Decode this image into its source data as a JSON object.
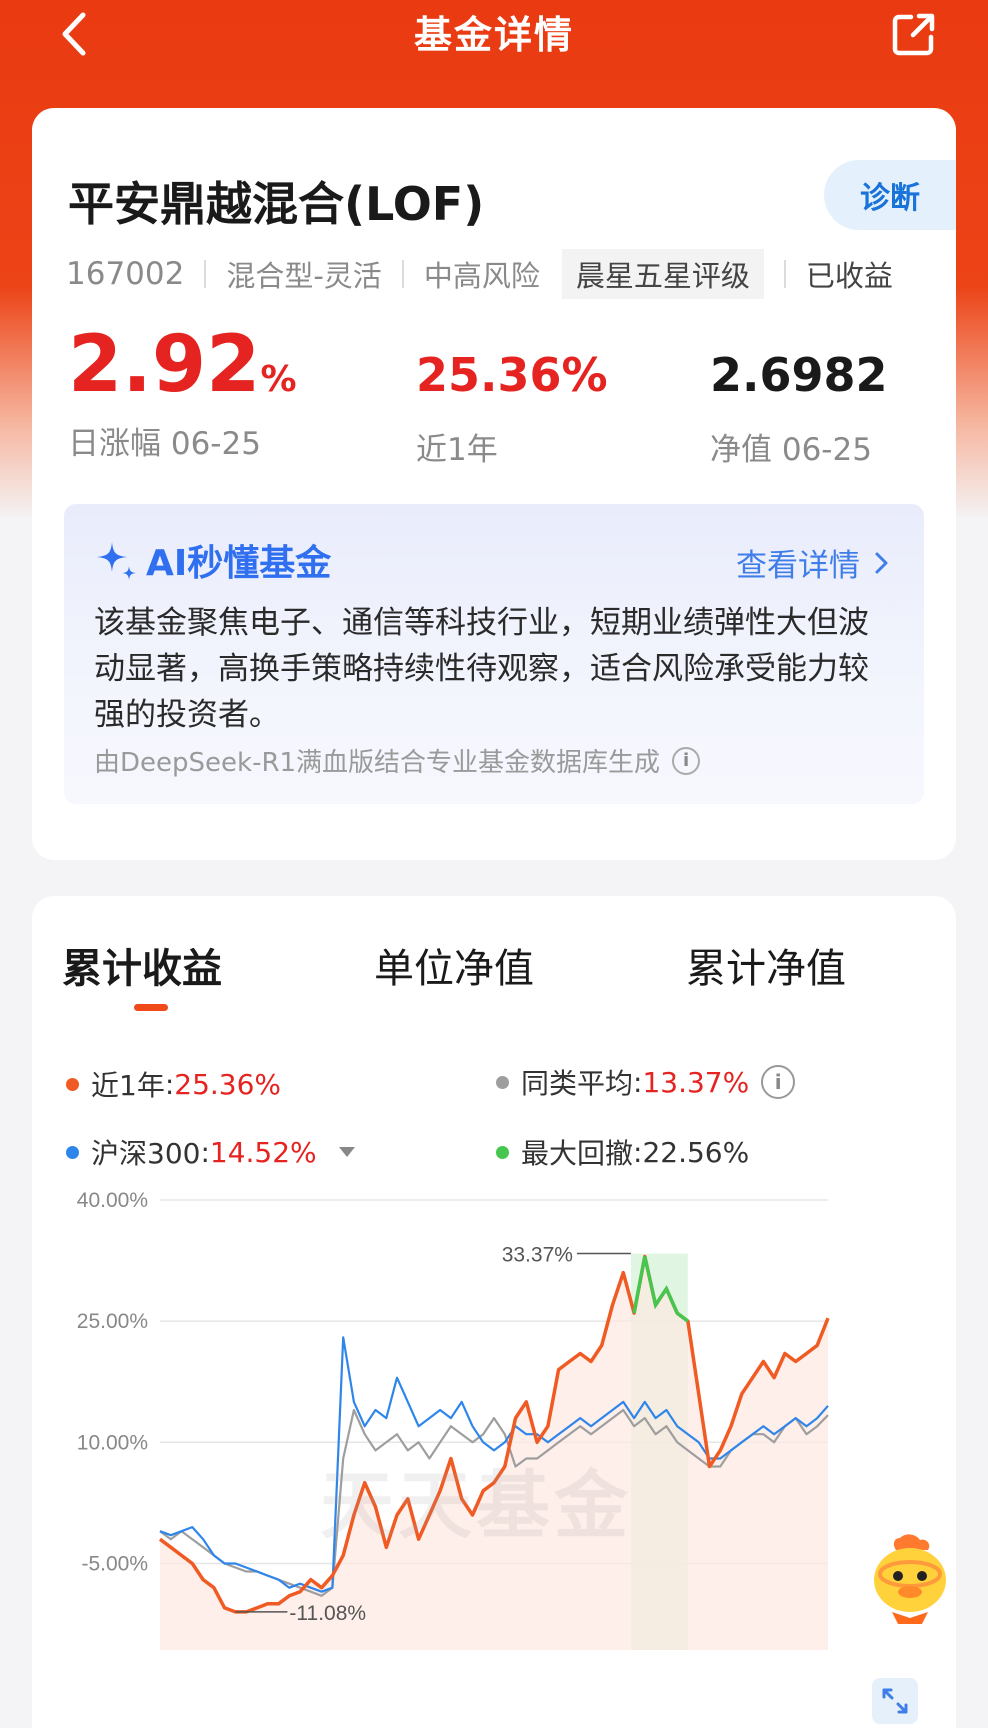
{
  "nav": {
    "title": "基金详情"
  },
  "fund": {
    "name": "平安鼎越混合(LOF)",
    "diagnose_label": "诊断",
    "code": "167002",
    "type": "混合型-灵活",
    "risk": "中高风险",
    "rating": "晨星五星评级",
    "extra": "已收益"
  },
  "stats": {
    "daily_change_value": "2.92",
    "daily_change_unit": "%",
    "daily_change_label": "日涨幅 06-25",
    "year_return_value": "25.36%",
    "year_return_label": "近1年",
    "nav_value": "2.6982",
    "nav_label": "净值 06-25"
  },
  "ai": {
    "title": "AI秒懂基金",
    "more_label": "查看详情",
    "summary": "该基金聚焦电子、通信等科技行业，短期业绩弹性大但波动显著，高换手策略持续性待观察，适合风险承受能力较强的投资者。",
    "note": "由DeepSeek-R1满血版结合专业基金数据库生成"
  },
  "tabs": [
    {
      "label": "累计收益",
      "active": true
    },
    {
      "label": "单位净值",
      "active": false
    },
    {
      "label": "累计净值",
      "active": false
    }
  ],
  "legend": [
    {
      "name": "近1年",
      "value": "25.36%",
      "color": "#f05a23"
    },
    {
      "name": "同类平均",
      "value": "13.37%",
      "color": "#9e9e9e"
    },
    {
      "name": "沪深300",
      "value": "14.52%",
      "color": "#2f86ea"
    },
    {
      "name": "最大回撤",
      "value": "22.56%",
      "color": "#45c64e"
    }
  ],
  "watermark": "天天基金",
  "colors": {
    "brand": "#ea3a11",
    "up_red": "#e52320",
    "fund_line": "#f05a23",
    "avg_line": "#9e9e9e",
    "index_line": "#2f86ea",
    "drawdown_line": "#45c64e"
  },
  "chart_data": {
    "type": "line",
    "y_ticks": [
      "40.00%",
      "25.00%",
      "10.00%",
      "-5.00%"
    ],
    "ylim": [
      -12,
      40
    ],
    "annotations": {
      "max": "33.37%",
      "min": "-11.08%"
    },
    "drawdown_range": [
      0.705,
      0.79
    ],
    "series": [
      {
        "name": "近1年",
        "color": "#f05a23",
        "values": [
          -2,
          -3,
          -4,
          -5,
          -7,
          -8,
          -10.5,
          -11,
          -11,
          -10.5,
          -10,
          -10,
          -9,
          -8.5,
          -7,
          -8,
          -6.5,
          -4,
          1,
          5,
          2,
          -3,
          1,
          3,
          -2,
          1,
          4,
          8,
          3,
          1,
          4,
          5,
          7,
          13,
          15,
          10,
          12,
          19,
          20,
          21,
          20,
          22,
          27,
          31,
          26,
          33,
          27,
          29,
          26,
          25,
          16,
          7,
          9,
          12,
          16,
          18,
          20,
          18,
          21,
          20,
          21,
          22,
          25.36
        ]
      },
      {
        "name": "同类平均",
        "color": "#9e9e9e",
        "values": [
          -1,
          -2,
          -1,
          -2,
          -3,
          -4,
          -5,
          -5.5,
          -6,
          -6,
          -6.5,
          -7,
          -7.5,
          -8,
          -8.5,
          -9,
          -8,
          8,
          14,
          11,
          9,
          10,
          11,
          9,
          10,
          8,
          10,
          12,
          11,
          10,
          11,
          13,
          11,
          7,
          8,
          8,
          9,
          10,
          11,
          12,
          11,
          12,
          13,
          14,
          12,
          13,
          11,
          12,
          10,
          9,
          8,
          7,
          7,
          9,
          10,
          11,
          11,
          10,
          12,
          13,
          11,
          12,
          13.37
        ]
      },
      {
        "name": "沪深300",
        "color": "#2f86ea",
        "values": [
          -1,
          -1.5,
          -1,
          -0.5,
          -2,
          -4,
          -5,
          -5,
          -5.5,
          -6,
          -6.5,
          -7,
          -8,
          -7.5,
          -8,
          -8.5,
          -8,
          23,
          15,
          12,
          14,
          13,
          18,
          15,
          12,
          13,
          14,
          13,
          15,
          12,
          10,
          9,
          10,
          12,
          11,
          11,
          10,
          11,
          12,
          13,
          12,
          13,
          14,
          15,
          13,
          15,
          13,
          14,
          12,
          11,
          10,
          8,
          8,
          9,
          10,
          11,
          12,
          11,
          12,
          13,
          12,
          13,
          14.52
        ]
      }
    ]
  }
}
